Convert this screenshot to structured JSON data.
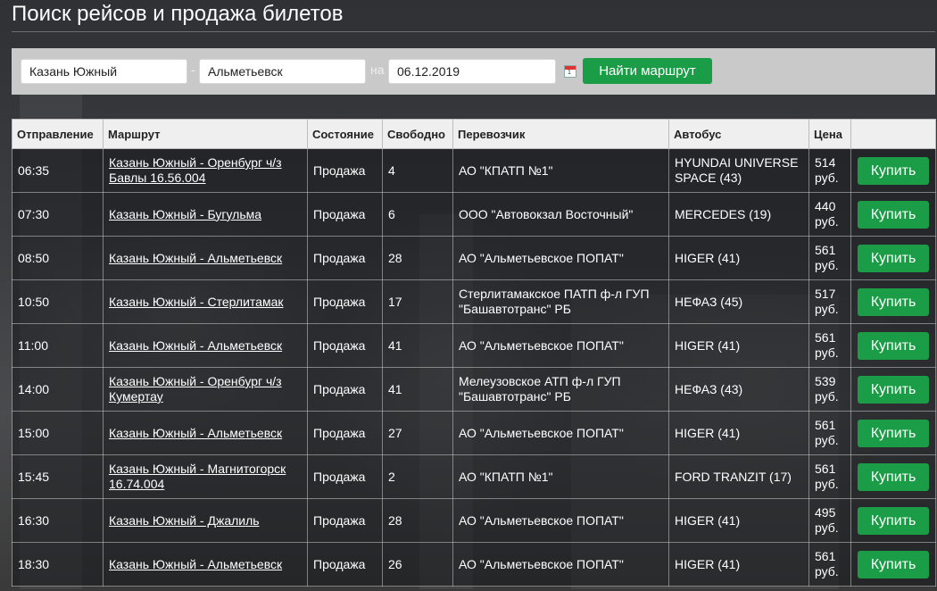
{
  "header": {
    "title": "Поиск рейсов и продажа билетов"
  },
  "search": {
    "from": "Казань Южный",
    "dash": "-",
    "to": "Альметьевск",
    "date_prefix": "на",
    "date": "06.12.2019",
    "calendar_icon": "calendar-icon",
    "calendar_day": "1",
    "submit_label": "Найти маршрут"
  },
  "colors": {
    "accent_green": "#1a9d46",
    "panel_gray": "#c9c9c9"
  },
  "table": {
    "headers": [
      "Отправление",
      "Маршрут",
      "Состояние",
      "Свободно",
      "Перевозчик",
      "Автобус",
      "Цена",
      ""
    ],
    "rows": [
      {
        "time": "06:35",
        "route": "Казань Южный - Оренбург ч/з Бавлы 16.56.004",
        "status": "Продажа",
        "free": "4",
        "carrier": "АО \"КПАТП №1\"",
        "bus": "HYUNDAI UNIVERSE SPACE (43)",
        "price": "514 руб.",
        "buy": "Купить"
      },
      {
        "time": "07:30",
        "route": "Казань Южный - Бугульма",
        "status": "Продажа",
        "free": "6",
        "carrier": "ООО \"Автовокзал Восточный\"",
        "bus": "MERCEDES (19)",
        "price": "440 руб.",
        "buy": "Купить"
      },
      {
        "time": "08:50",
        "route": "Казань Южный - Альметьевск",
        "status": "Продажа",
        "free": "28",
        "carrier": "АО \"Альметьевское ПОПАТ\"",
        "bus": "HIGER (41)",
        "price": "561 руб.",
        "buy": "Купить"
      },
      {
        "time": "10:50",
        "route": "Казань Южный - Стерлитамак",
        "status": "Продажа",
        "free": "17",
        "carrier": "Стерлитамакское ПАТП ф-л ГУП \"Башавтотранс\" РБ",
        "bus": "НЕФАЗ (45)",
        "price": "517 руб.",
        "buy": "Купить"
      },
      {
        "time": "11:00",
        "route": "Казань Южный - Альметьевск",
        "status": "Продажа",
        "free": "41",
        "carrier": "АО \"Альметьевское ПОПАТ\"",
        "bus": "HIGER (41)",
        "price": "561 руб.",
        "buy": "Купить"
      },
      {
        "time": "14:00",
        "route": "Казань Южный - Оренбург ч/з Кумертау",
        "status": "Продажа",
        "free": "41",
        "carrier": "Мелеузовское АТП ф-л ГУП \"Башавтотранс\" РБ",
        "bus": "НЕФАЗ (43)",
        "price": "539 руб.",
        "buy": "Купить"
      },
      {
        "time": "15:00",
        "route": "Казань Южный - Альметьевск",
        "status": "Продажа",
        "free": "27",
        "carrier": "АО \"Альметьевское ПОПАТ\"",
        "bus": "HIGER (41)",
        "price": "561 руб.",
        "buy": "Купить"
      },
      {
        "time": "15:45",
        "route": "Казань Южный - Магнитогорск 16.74.004",
        "status": "Продажа",
        "free": "2",
        "carrier": "АО \"КПАТП №1\"",
        "bus": "FORD TRANZIT (17)",
        "price": "561 руб.",
        "buy": "Купить"
      },
      {
        "time": "16:30",
        "route": "Казань Южный - Джалиль",
        "status": "Продажа",
        "free": "28",
        "carrier": "АО \"Альметьевское ПОПАТ\"",
        "bus": "HIGER (41)",
        "price": "495 руб.",
        "buy": "Купить"
      },
      {
        "time": "18:30",
        "route": "Казань Южный - Альметьевск",
        "status": "Продажа",
        "free": "26",
        "carrier": "АО \"Альметьевское ПОПАТ\"",
        "bus": "HIGER (41)",
        "price": "561 руб.",
        "buy": "Купить"
      }
    ]
  }
}
